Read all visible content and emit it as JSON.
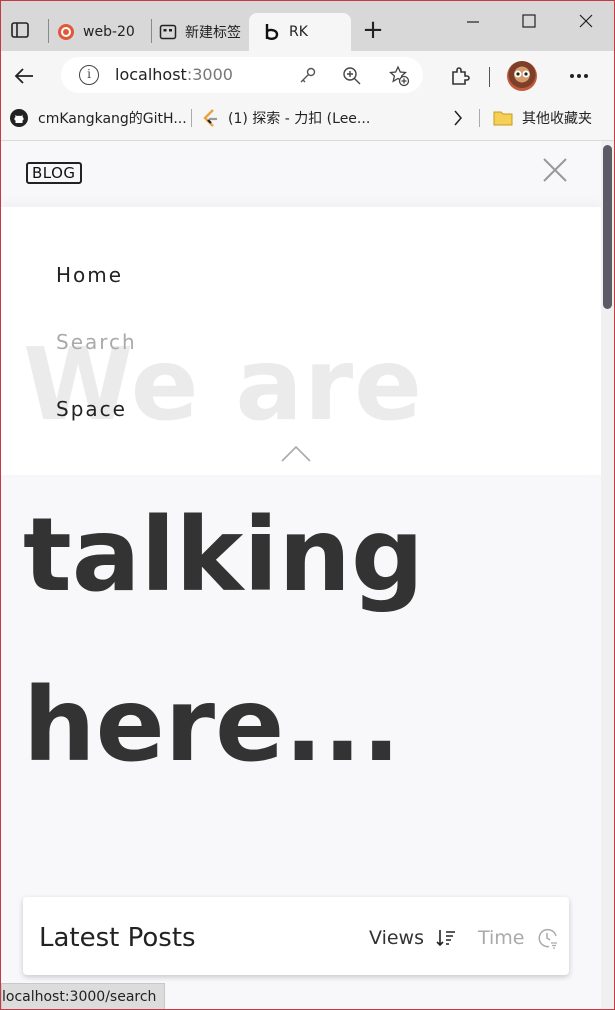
{
  "browser": {
    "tabs": [
      {
        "label": "web-20",
        "icon": "git-icon"
      },
      {
        "label": "新建标签",
        "icon": "new-tab-page-icon"
      },
      {
        "label": "RK",
        "icon": "blog-b-icon",
        "active": true
      }
    ],
    "new_tab_label": "+",
    "address": {
      "host": "localhost",
      "port": ":3000"
    },
    "bookmarks": [
      {
        "label": "cmKangkang的GitH...",
        "icon": "github-icon"
      },
      {
        "label": "(1) 探索 - 力扣 (Lee...",
        "icon": "leetcode-icon"
      },
      {
        "label": "其他收藏夹",
        "icon": "folder-icon"
      }
    ],
    "status_url": "localhost:3000/search",
    "accent_color": "#c43b48"
  },
  "site": {
    "logo": "BLOG",
    "nav": [
      {
        "label": "Home"
      },
      {
        "label": "Search"
      },
      {
        "label": "Space"
      }
    ],
    "hero": {
      "line1": "We are",
      "line2": "talking",
      "line3": "here..."
    },
    "posts": {
      "title": "Latest Posts",
      "sort_views": "Views",
      "sort_time": "Time"
    }
  }
}
